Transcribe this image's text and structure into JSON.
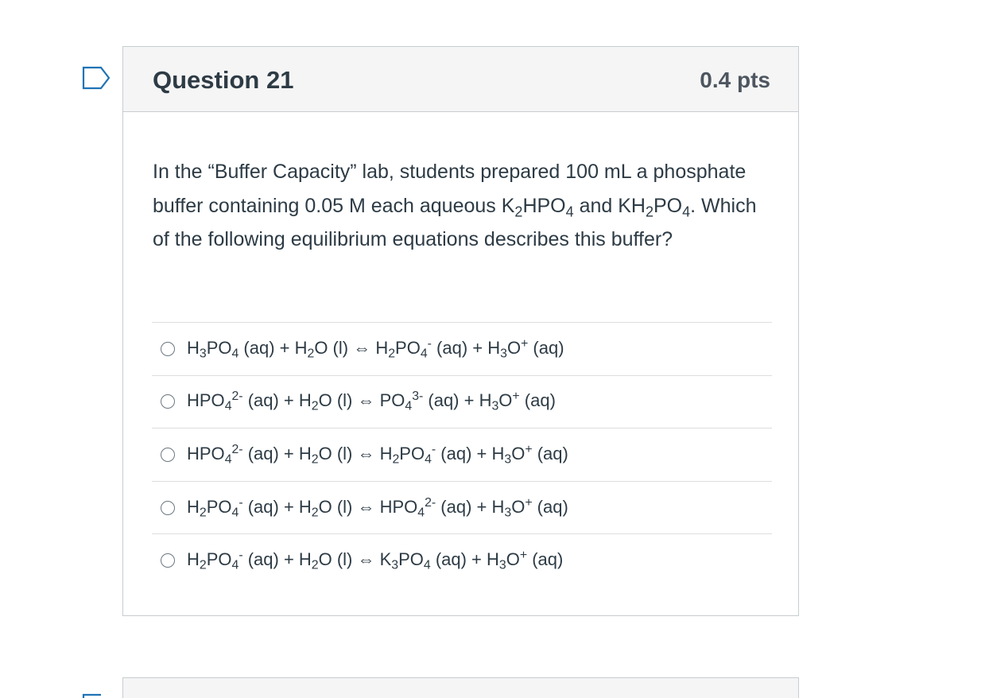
{
  "question": {
    "title": "Question 21",
    "points": "0.4 pts",
    "text_parts": {
      "p1": "In the “Buffer Capacity” lab, students prepared 100 mL a phosphate buffer containing 0.05 M each aqueous K",
      "p2": "2",
      "p3": "HPO",
      "p4": "4",
      "p5": " and KH",
      "p6": "2",
      "p7": "PO",
      "p8": "4",
      "p9": ". Which of the following equilibrium equations describes this buffer?"
    }
  },
  "answers": [
    {
      "parts": [
        {
          "t": "H"
        },
        {
          "sub": "3"
        },
        {
          "t": "PO"
        },
        {
          "sub": "4"
        },
        {
          "t": " (aq) + H"
        },
        {
          "sub": "2"
        },
        {
          "t": "O (l) ⇔ H"
        },
        {
          "sub": "2"
        },
        {
          "t": "PO"
        },
        {
          "sub": "4"
        },
        {
          "sup": "-"
        },
        {
          "t": " (aq) + H"
        },
        {
          "sub": "3"
        },
        {
          "t": "O"
        },
        {
          "sup": "+"
        },
        {
          "t": " (aq)"
        }
      ]
    },
    {
      "parts": [
        {
          "t": "HPO"
        },
        {
          "sub": "4"
        },
        {
          "sup": "2-"
        },
        {
          "t": " (aq) + H"
        },
        {
          "sub": "2"
        },
        {
          "t": "O (l) ⇔ PO"
        },
        {
          "sub": "4"
        },
        {
          "sup": "3-"
        },
        {
          "t": " (aq) + H"
        },
        {
          "sub": "3"
        },
        {
          "t": "O"
        },
        {
          "sup": "+"
        },
        {
          "t": " (aq)"
        }
      ]
    },
    {
      "parts": [
        {
          "t": "HPO"
        },
        {
          "sub": "4"
        },
        {
          "sup": "2-"
        },
        {
          "t": " (aq) + H"
        },
        {
          "sub": "2"
        },
        {
          "t": "O (l) ⇔ H"
        },
        {
          "sub": "2"
        },
        {
          "t": "PO"
        },
        {
          "sub": "4"
        },
        {
          "sup": "-"
        },
        {
          "t": " (aq) + H"
        },
        {
          "sub": "3"
        },
        {
          "t": "O"
        },
        {
          "sup": "+"
        },
        {
          "t": " (aq)"
        }
      ]
    },
    {
      "parts": [
        {
          "t": "H"
        },
        {
          "sub": "2"
        },
        {
          "t": "PO"
        },
        {
          "sub": "4"
        },
        {
          "sup": "-"
        },
        {
          "t": " (aq) + H"
        },
        {
          "sub": "2"
        },
        {
          "t": "O (l) ⇔ HPO"
        },
        {
          "sub": "4"
        },
        {
          "sup": "2-"
        },
        {
          "t": " (aq) + H"
        },
        {
          "sub": "3"
        },
        {
          "t": "O"
        },
        {
          "sup": "+"
        },
        {
          "t": " (aq)"
        }
      ]
    },
    {
      "parts": [
        {
          "t": "H"
        },
        {
          "sub": "2"
        },
        {
          "t": "PO"
        },
        {
          "sub": "4"
        },
        {
          "sup": "-"
        },
        {
          "t": " (aq) + H"
        },
        {
          "sub": "2"
        },
        {
          "t": "O (l) ⇔ K"
        },
        {
          "sub": "3"
        },
        {
          "t": "PO"
        },
        {
          "sub": "4"
        },
        {
          "t": " (aq) + H"
        },
        {
          "sub": "3"
        },
        {
          "t": "O"
        },
        {
          "sup": "+"
        },
        {
          "t": " (aq)"
        }
      ]
    }
  ],
  "icons": {
    "flag": "flag-question-icon"
  },
  "colors": {
    "flag_stroke": "#1f73b5",
    "header_bg": "#f5f5f5",
    "border": "#c7cdd1",
    "text": "#2d3b45"
  }
}
